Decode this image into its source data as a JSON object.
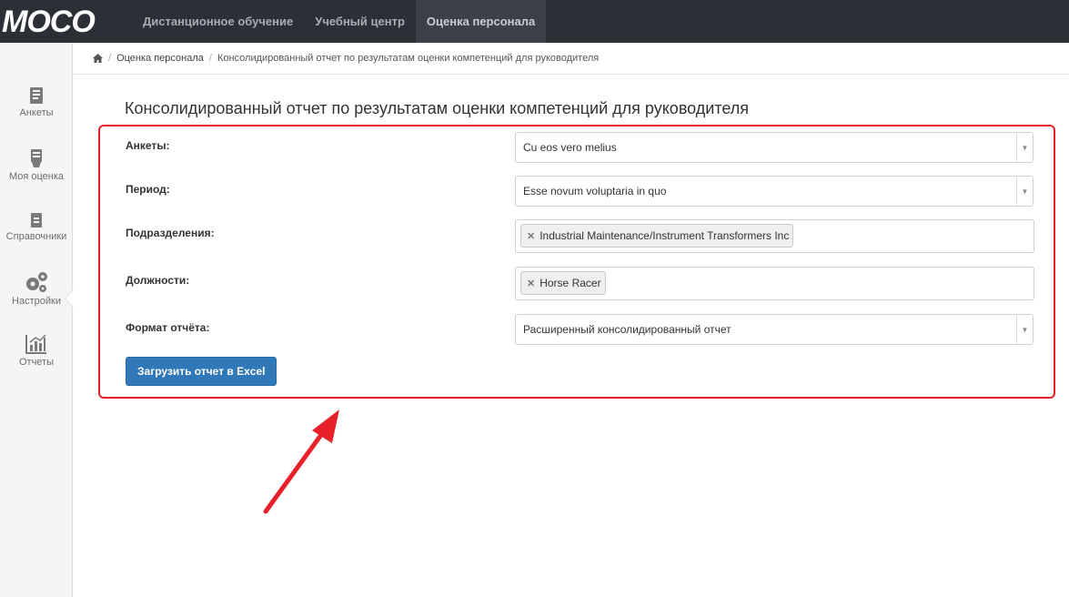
{
  "brand": {
    "logo_text": "MOCO"
  },
  "topnav": {
    "items": [
      {
        "label": "Дистанционное обучение"
      },
      {
        "label": "Учебный центр"
      },
      {
        "label": "Оценка персонала"
      }
    ]
  },
  "sidebar": {
    "items": [
      {
        "label": "Анкеты",
        "icon": "questionnaire-icon"
      },
      {
        "label": "Моя оценка",
        "icon": "my-assessment-icon"
      },
      {
        "label": "Справочники",
        "icon": "directory-icon"
      },
      {
        "label": "Настройки",
        "icon": "gears-icon"
      },
      {
        "label": "Отчеты",
        "icon": "chart-icon"
      }
    ]
  },
  "breadcrumb": {
    "section": "Оценка персонала",
    "current": "Консолидированный отчет по результатам оценки компетенций для руководителя"
  },
  "page": {
    "title": "Консолидированный отчет по результатам оценки компетенций для руководителя"
  },
  "form": {
    "questionnaires": {
      "label": "Анкеты:",
      "value": "Cu eos vero melius"
    },
    "period": {
      "label": "Период:",
      "value": "Esse novum voluptaria in quo"
    },
    "departments": {
      "label": "Подразделения:",
      "tags": [
        "Industrial Maintenance/Instrument Transformers Inc"
      ]
    },
    "positions": {
      "label": "Должности:",
      "tags": [
        "Horse Racer"
      ]
    },
    "report_format": {
      "label": "Формат отчёта:",
      "value": "Расширенный консолидированный отчет"
    },
    "submit_label": "Загрузить отчет в Excel"
  },
  "colors": {
    "topbar": "#2b2f36",
    "primary_button": "#3178b8",
    "highlight": "#e8202a"
  }
}
